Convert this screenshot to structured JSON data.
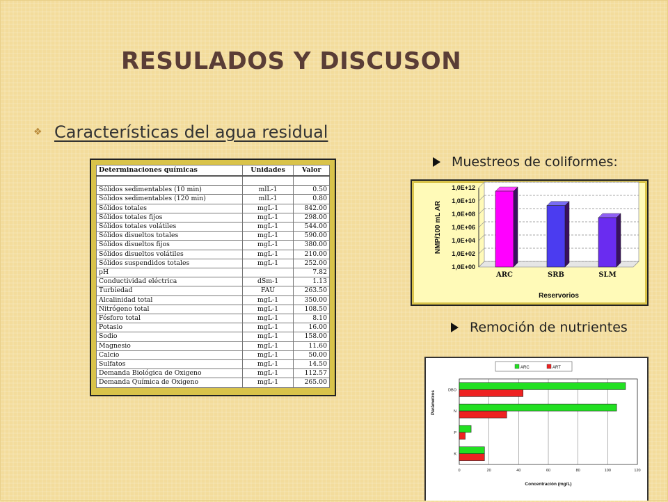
{
  "slide": {
    "title": "RESULADOS Y DISCUSON",
    "subtitle": "Características del agua residual",
    "label_coliforms": "Muestreos de coliformes:",
    "label_nutrients": "Remoción de nutrientes"
  },
  "table": {
    "headers": [
      "Determinaciones químicas",
      "Unidades",
      "Valor"
    ],
    "rows": [
      [
        "Sólidos sedimentables (10 min)",
        "mlL-1",
        "0.50"
      ],
      [
        "Sólidos sedimentables (120 min)",
        "mlL-1",
        "0.80"
      ],
      [
        "Sólidos totales",
        "mgL-1",
        "842.00"
      ],
      [
        "Sólidos totales fijos",
        "mgL-1",
        "298.00"
      ],
      [
        "Sólidos totales volátiles",
        "mgL-1",
        "544.00"
      ],
      [
        "Sólidos disueltos totales",
        "mgL-1",
        "590.00"
      ],
      [
        "Sólidos disueltos fijos",
        "mgL-1",
        "380.00"
      ],
      [
        "Sólidos disueltos volátiles",
        "mgL-1",
        "210.00"
      ],
      [
        "Sólidos suspendidos totales",
        "mgL-1",
        "252.00"
      ],
      [
        "pH",
        "",
        "7.82"
      ],
      [
        "Conductividad eléctrica",
        "dSm-1",
        "1.13"
      ],
      [
        "Turbiedad",
        "FAU",
        "263.50"
      ],
      [
        "Alcalinidad total",
        "mgL-1",
        "350.00"
      ],
      [
        "Nitrógeno total",
        "mgL-1",
        "108.50"
      ],
      [
        "Fósforo total",
        "mgL-1",
        "8.10"
      ],
      [
        "Potasio",
        "mgL-1",
        "16.00"
      ],
      [
        "Sodio",
        "mgL-1",
        "158.00"
      ],
      [
        "Magnesio",
        "mgL-1",
        "11.60"
      ],
      [
        "Calcio",
        "mgL-1",
        "50.00"
      ],
      [
        "Sulfatos",
        "mgL-1",
        "14.50"
      ],
      [
        "Demanda Biológica de Oxigeno",
        "mgL-1",
        "112.57"
      ],
      [
        "Demanda Química de Oxigeno",
        "mgL-1",
        "265.00"
      ]
    ]
  },
  "chart_data": [
    {
      "type": "bar",
      "scale": "log",
      "categories": [
        "ARC",
        "SRB",
        "SLM"
      ],
      "values": [
        300000000000.0,
        2000000000.0,
        30000000.0
      ],
      "ylabel": "NMP/100 mL AR",
      "xlabel": "Reservorios",
      "yticks": [
        "1,0E+00",
        "1,0E+02",
        "1,0E+04",
        "1,0E+06",
        "1,0E+08",
        "1,0E+10",
        "1,0E+12"
      ],
      "ylim": [
        1,
        1000000000000.0
      ],
      "bar_colors": [
        "#ff00ff",
        "#4b3cf0",
        "#6a2cf0"
      ],
      "grid": true
    },
    {
      "type": "bar",
      "orientation": "horizontal",
      "categories": [
        "DBO",
        "N",
        "P",
        "K"
      ],
      "series": [
        {
          "name": "ARC",
          "values": [
            112,
            106,
            8,
            17
          ],
          "color": "#22e022"
        },
        {
          "name": "ART",
          "values": [
            43,
            32,
            4,
            17
          ],
          "color": "#ee2222"
        }
      ],
      "xticks": [
        "0",
        "20",
        "40",
        "60",
        "80",
        "100",
        "120"
      ],
      "xlim": [
        0,
        120
      ],
      "xlabel": "Concentración (mg/L)",
      "ylabel": "Parámetros",
      "legend": "top"
    }
  ]
}
